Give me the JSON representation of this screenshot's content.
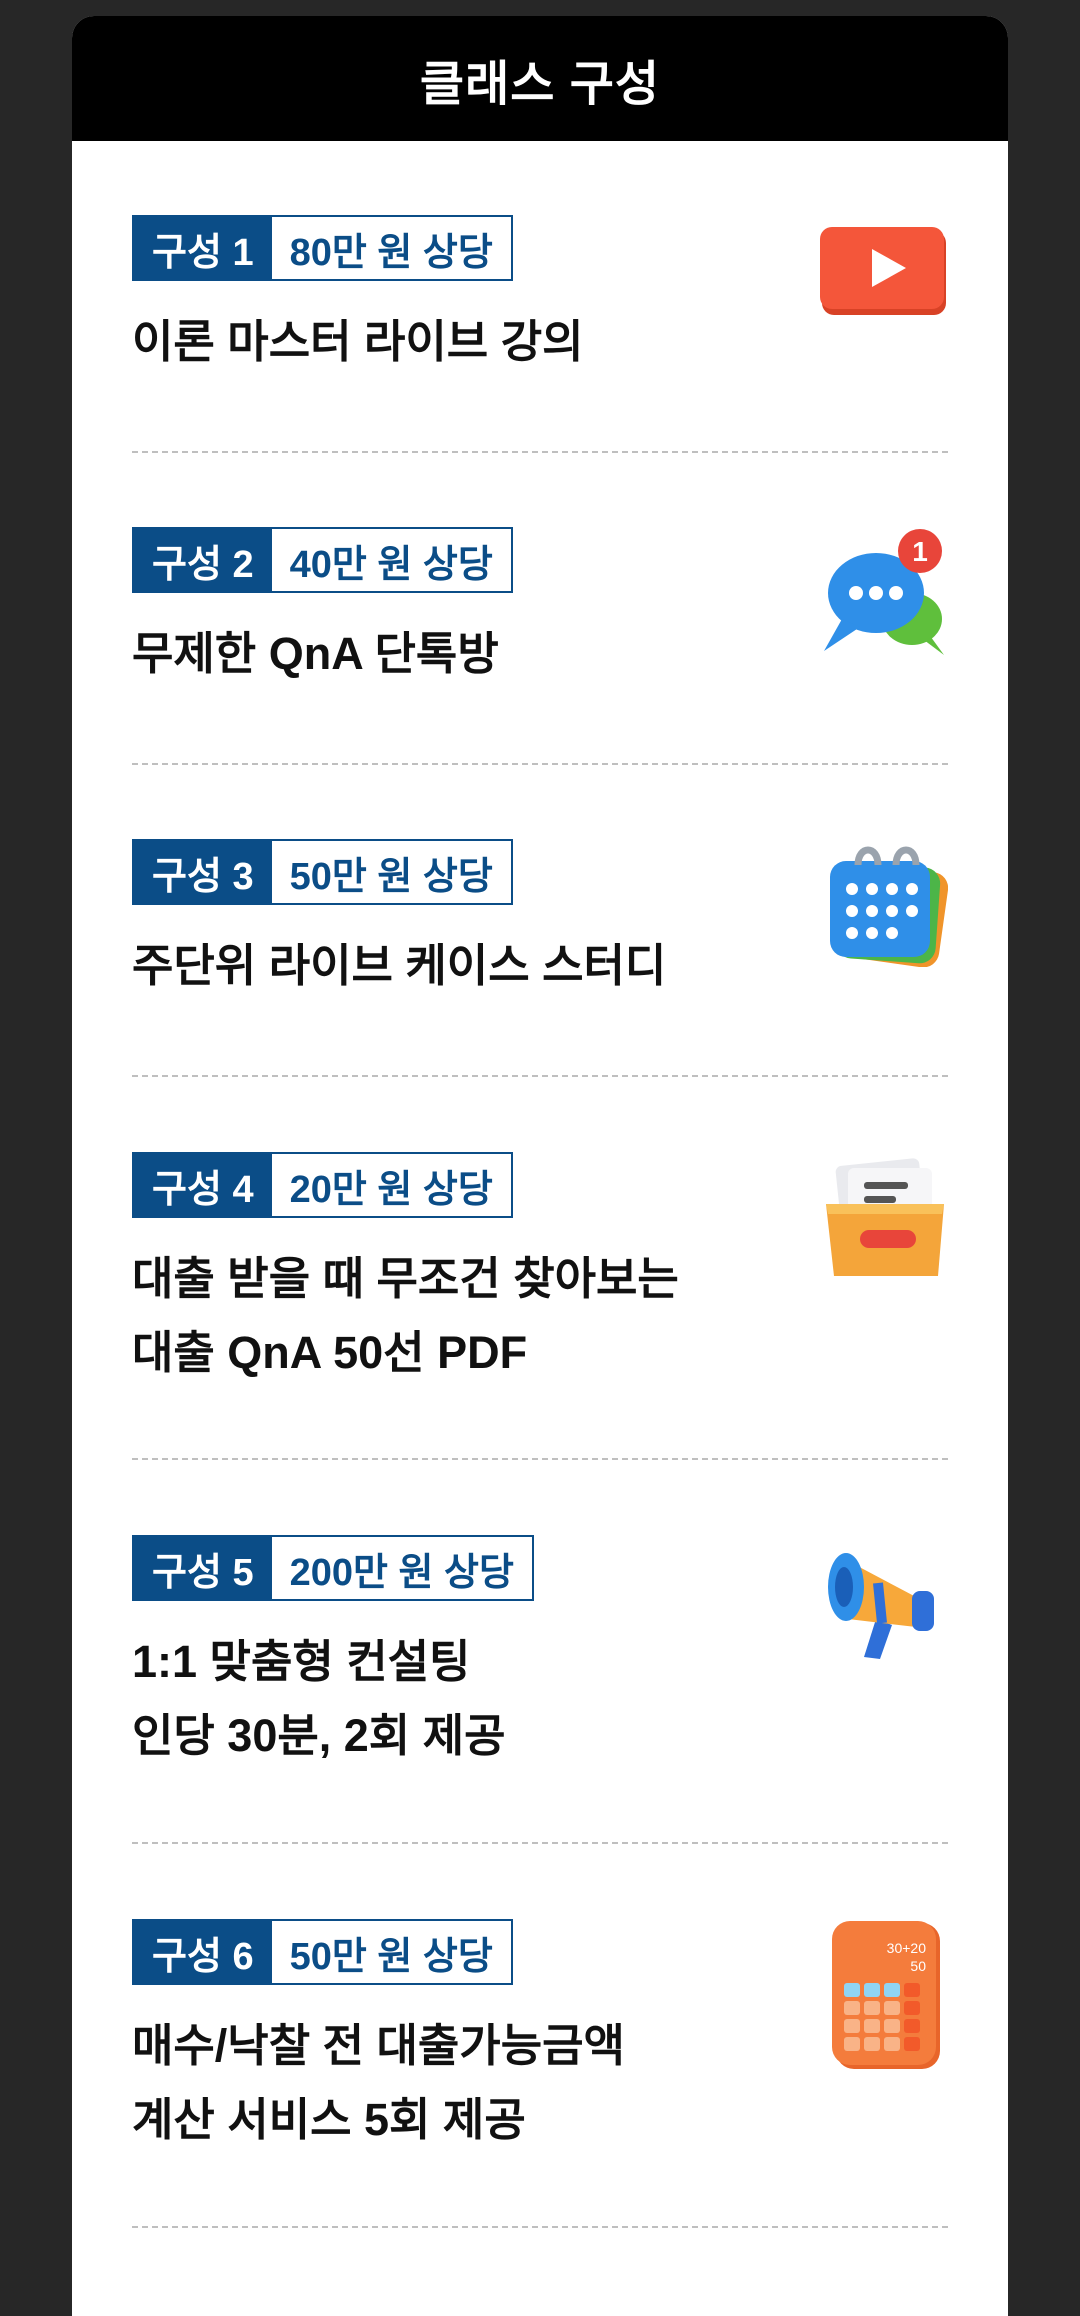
{
  "header": {
    "title": "클래스 구성"
  },
  "sections": [
    {
      "num": "구성 1",
      "value": "80만 원 상당",
      "lines": [
        "이론 마스터 라이브 강의",
        ""
      ],
      "icon": "play-button-icon"
    },
    {
      "num": "구성 2",
      "value": "40만 원 상당",
      "lines": [
        "무제한 QnA 단톡방",
        ""
      ],
      "icon": "chat-bubbles-icon",
      "badge": "1"
    },
    {
      "num": "구성 3",
      "value": "50만 원 상당",
      "lines": [
        "주단위 라이브 케이스 스터디",
        ""
      ],
      "icon": "calendar-icon"
    },
    {
      "num": "구성 4",
      "value": "20만 원 상당",
      "lines": [
        "대출 받을 때 무조건 찾아보는",
        "대출 QnA 50선 PDF"
      ],
      "icon": "folder-icon"
    },
    {
      "num": "구성 5",
      "value": "200만 원 상당",
      "lines": [
        "1:1 맞춤형 컨설팅",
        "인당 30분, 2회 제공"
      ],
      "icon": "megaphone-icon"
    },
    {
      "num": "구성 6",
      "value": "50만 원 상당",
      "lines": [
        "매수/낙찰 전 대출가능금액",
        "계산 서비스 5회 제공"
      ],
      "icon": "calculator-icon",
      "calc_expr": "30+20",
      "calc_result": "50"
    }
  ]
}
